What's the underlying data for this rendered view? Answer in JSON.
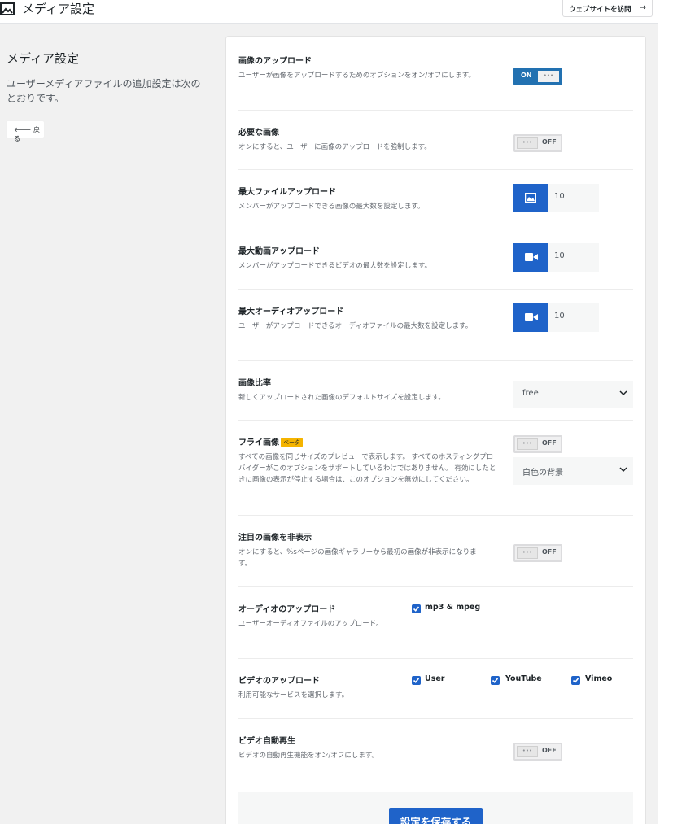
{
  "header": {
    "title": "メディア設定",
    "visit_site_label": "ウェブサイトを訪問",
    "visit_arrow": "→"
  },
  "sidebar": {
    "title": "メディア設定",
    "description": "ユーザーメディアファイルの追加設定は次のとおりです。",
    "back_label": "🡐 戻る"
  },
  "settings": {
    "image_upload": {
      "title": "画像のアップロード",
      "desc": "ユーザーが画像をアップロードするためのオプションをオン/オフにします。",
      "toggle": "ON"
    },
    "required_image": {
      "title": "必要な画像",
      "desc": "オンにすると、ユーザーに画像のアップロードを強制します。",
      "toggle": "OFF"
    },
    "max_file_upload": {
      "title": "最大ファイルアップロード",
      "desc": "メンバーがアップロードできる画像の最大数を設定します。",
      "value": "10",
      "icon": "image-icon"
    },
    "max_video_upload": {
      "title": "最大動画アップロード",
      "desc": "メンバーがアップロードできるビデオの最大数を設定します。",
      "value": "10",
      "icon": "video-camera-icon"
    },
    "max_audio_upload": {
      "title": "最大オーディオアップロード",
      "desc": "ユーザーがアップロードできるオーディオファイルの最大数を設定します。",
      "value": "10",
      "icon": "video-camera-icon"
    },
    "image_ratio": {
      "title": "画像比率",
      "desc": "新しくアップロードされた画像のデフォルトサイズを設定します。",
      "selected": "free"
    },
    "fly_image": {
      "title": "フライ画像",
      "badge": "ベータ",
      "desc": "すべての画像を同じサイズのプレビューで表示します。 すべてのホスティングプロバイダーがこのオプションをサポートしているわけではありません。 有効にしたときに画像の表示が停止する場合は、このオプションを無効にしてください。",
      "toggle": "OFF",
      "selected": "白色の背景"
    },
    "hide_featured": {
      "title": "注目の画像を非表示",
      "desc": "オンにすると、%sページの画像ギャラリーから最初の画像が非表示になります。",
      "toggle": "OFF"
    },
    "audio_upload": {
      "title": "オーディオのアップロード",
      "desc": "ユーザーオーディオファイルのアップロード。",
      "option": "mp3 & mpeg"
    },
    "video_upload": {
      "title": "ビデオのアップロード",
      "desc": "利用可能なサービスを選択します。",
      "options": [
        "User",
        "YouTube",
        "Vimeo"
      ]
    },
    "video_autoplay": {
      "title": "ビデオ自動再生",
      "desc": "ビデオの自動再生機能をオン/オフにします。",
      "toggle": "OFF"
    }
  },
  "knob_dots": "•••",
  "save_label": "設定を保存する",
  "colors": {
    "accent": "#1f63c9",
    "badge": "#f5b400",
    "background": "#f1f1f1"
  }
}
